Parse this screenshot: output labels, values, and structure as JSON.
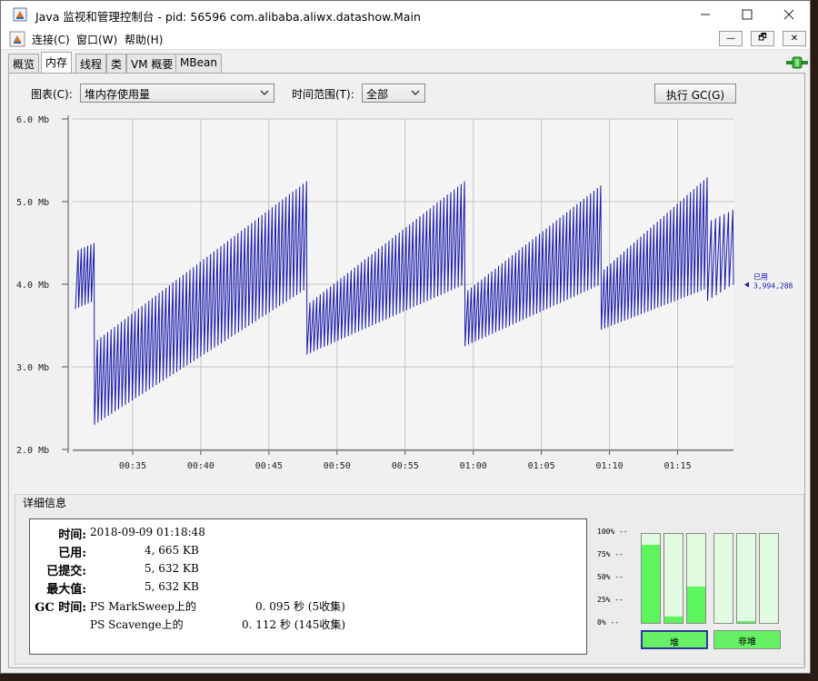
{
  "window": {
    "title": "Java 监视和管理控制台 - pid: 56596 com.alibaba.aliwx.datashow.Main",
    "controls": {
      "minimize": "—",
      "maximize": "☐",
      "close": "✕"
    }
  },
  "menu": {
    "items": [
      "连接(C)",
      "窗口(W)",
      "帮助(H)"
    ],
    "mdi_controls": [
      "—",
      "🗗",
      "✕"
    ]
  },
  "tabs": [
    "概览",
    "内存",
    "线程",
    "类",
    "VM 概要",
    "MBean"
  ],
  "active_tab": "内存",
  "toolbar": {
    "chart_label": "图表(C):",
    "chart_value": "堆内存使用量",
    "range_label": "时间范围(T):",
    "range_value": "全部",
    "gc_button": "执行 GC(G)"
  },
  "chart_data": {
    "type": "line",
    "y_ticks": [
      "6.0 Mb",
      "5.0 Mb",
      "4.0 Mb",
      "3.0 Mb",
      "2.0 Mb"
    ],
    "x_ticks": [
      "00:35",
      "00:40",
      "00:45",
      "00:50",
      "00:55",
      "01:00",
      "01:05",
      "01:10",
      "01:15"
    ],
    "ylim": [
      2.0,
      6.0
    ],
    "x_range_minutes": [
      0.0,
      48.5
    ],
    "x_tick_minutes": [
      4.4,
      9.4,
      14.4,
      19.4,
      24.4,
      29.4,
      34.4,
      39.4,
      44.4
    ],
    "grid": true,
    "series": [
      {
        "name": "已用",
        "value_label": "3,994,288",
        "color": "#1a1aaa",
        "cycles": [
          {
            "start_min": 0.2,
            "end_min": 1.6,
            "low_start": 3.7,
            "low_end": 3.8,
            "high_start": 4.4,
            "high_end": 4.5,
            "teeth": 6
          },
          {
            "start_min": 1.6,
            "end_min": 17.2,
            "low_start": 2.3,
            "low_end": 3.95,
            "high_start": 3.3,
            "high_end": 5.25,
            "teeth": 62
          },
          {
            "start_min": 17.2,
            "end_min": 28.8,
            "low_start": 3.15,
            "low_end": 4.0,
            "high_start": 3.75,
            "high_end": 5.25,
            "teeth": 46
          },
          {
            "start_min": 28.8,
            "end_min": 38.8,
            "low_start": 3.25,
            "low_end": 4.0,
            "high_start": 3.9,
            "high_end": 5.2,
            "teeth": 40
          },
          {
            "start_min": 38.8,
            "end_min": 46.6,
            "low_start": 3.45,
            "low_end": 3.95,
            "high_start": 4.15,
            "high_end": 5.3,
            "teeth": 32
          },
          {
            "start_min": 46.6,
            "end_min": 48.5,
            "low_start": 3.8,
            "low_end": 4.0,
            "high_start": 4.75,
            "high_end": 4.9,
            "teeth": 6
          }
        ]
      }
    ]
  },
  "details": {
    "section_title": "详细信息",
    "time_label": "时间:",
    "time_value": "2018-09-09 01:18:48",
    "used_label": "已用:",
    "used_value": "4, 665 KB",
    "committed_label": "已提交:",
    "committed_value": "5, 632 KB",
    "max_label": "最大值:",
    "max_value": "5, 632 KB",
    "gc_label": "GC 时间:",
    "gc_rows": [
      {
        "name": "PS MarkSweep上的",
        "time": "0. 095 秒 (5收集)"
      },
      {
        "name": "PS Scavenge上的",
        "time": "0. 112 秒 (145收集)"
      }
    ]
  },
  "pools": {
    "percent_labels": [
      "100% --",
      "75% --",
      "50% --",
      "25% --",
      "0% --"
    ],
    "heap_bars": [
      0.88,
      0.07,
      0.41
    ],
    "nonheap_bars": [
      0.0,
      0.02,
      0.0
    ],
    "heap_label": "堆",
    "nonheap_label": "非堆"
  }
}
